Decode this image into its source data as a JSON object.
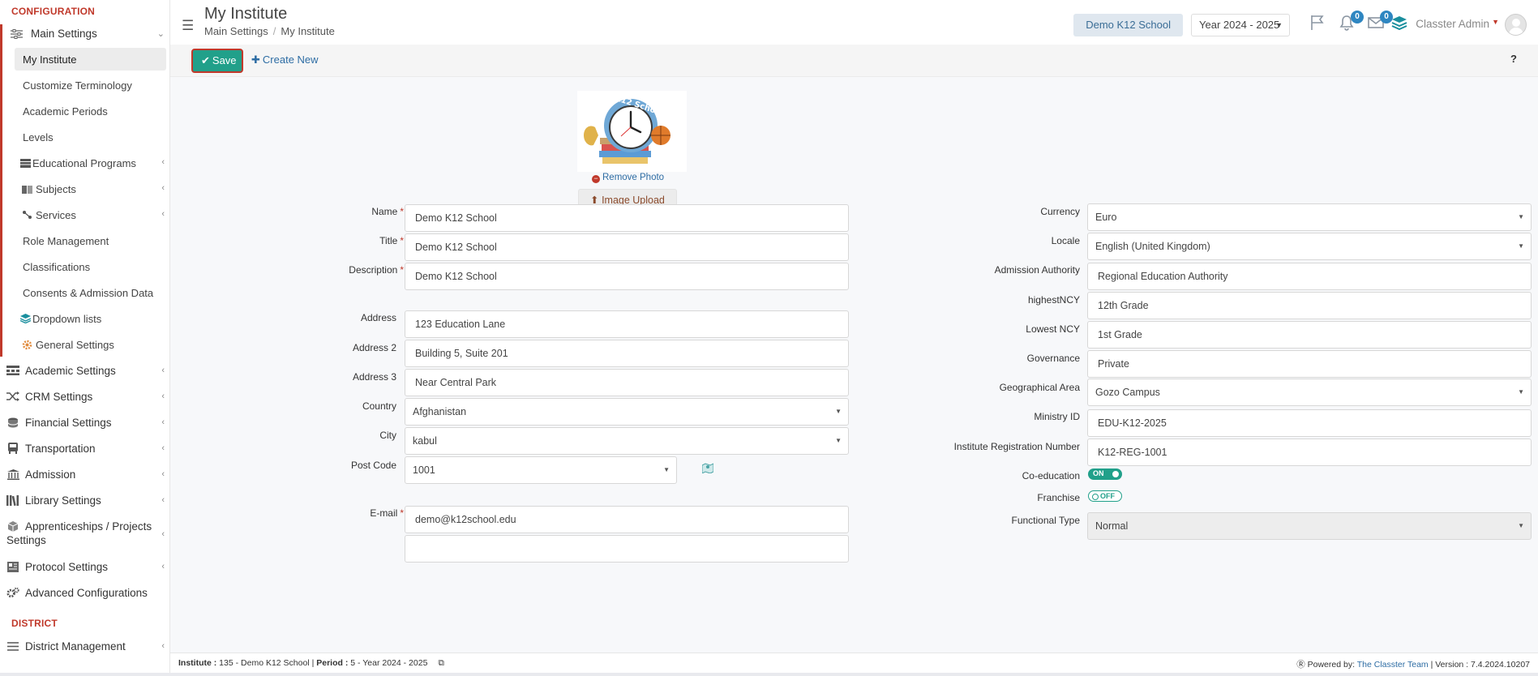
{
  "sidebar": {
    "configuration_heading": "CONFIGURATION",
    "main_settings": "Main Settings",
    "sub_items": {
      "my_institute": "My Institute",
      "customize_terminology": "Customize Terminology",
      "academic_periods": "Academic Periods",
      "levels": "Levels",
      "educational_programs": "Educational Programs",
      "subjects": "Subjects",
      "services": "Services",
      "role_management": "Role Management",
      "classifications": "Classifications",
      "consents": "Consents & Admission Data",
      "dropdown_lists": "Dropdown lists",
      "general_settings": "General Settings"
    },
    "top_items": {
      "academic_settings": "Academic Settings",
      "crm_settings": "CRM Settings",
      "financial_settings": "Financial Settings",
      "transportation": "Transportation",
      "admission": "Admission",
      "library_settings": "Library Settings",
      "apprenticeships_line1": "Apprenticeships / Projects",
      "apprenticeships_line2": "Settings",
      "protocol_settings": "Protocol Settings",
      "advanced_configurations": "Advanced Configurations"
    },
    "district_heading": "DISTRICT",
    "district_management": "District Management"
  },
  "header": {
    "title": "My Institute",
    "breadcrumb_parent": "Main Settings",
    "breadcrumb_sep": "/",
    "breadcrumb_current": "My Institute",
    "school": "Demo K12 School",
    "year": "Year 2024 - 2025",
    "notifications_count": "0",
    "messages_count": "0",
    "user_name": "Classter Admin"
  },
  "toolbar": {
    "save_label": "Save",
    "create_new_label": "Create New",
    "help_label": "?"
  },
  "photo": {
    "logo_text": "My K12 School",
    "remove_label": "Remove Photo",
    "upload_label": "Image Upload"
  },
  "form_left": {
    "name_label": "Name",
    "name_value": "Demo K12 School",
    "title_label": "Title",
    "title_value": "Demo K12 School",
    "description_label": "Description",
    "description_value": "Demo K12 School",
    "address_label": "Address",
    "address_value": "123 Education Lane",
    "address2_label": "Address 2",
    "address2_value": "Building 5, Suite 201",
    "address3_label": "Address 3",
    "address3_value": "Near Central Park",
    "country_label": "Country",
    "country_value": "Afghanistan",
    "city_label": "City",
    "city_value": "kabul",
    "postcode_label": "Post Code",
    "postcode_value": "1001",
    "email_label": "E-mail",
    "email_value": "demo@k12school.edu",
    "required_mark": "*"
  },
  "form_right": {
    "currency_label": "Currency",
    "currency_value": "Euro",
    "locale_label": "Locale",
    "locale_value": "English (United Kingdom)",
    "admission_authority_label": "Admission Authority",
    "admission_authority_value": "Regional Education Authority",
    "highest_ncy_label": "highestNCY",
    "highest_ncy_value": "12th Grade",
    "lowest_ncy_label": "Lowest NCY",
    "lowest_ncy_value": "1st Grade",
    "governance_label": "Governance",
    "governance_value": "Private",
    "geo_area_label": "Geographical Area",
    "geo_area_value": "Gozo Campus",
    "ministry_id_label": "Ministry ID",
    "ministry_id_value": "EDU-K12-2025",
    "reg_number_label": "Institute Registration Number",
    "reg_number_value": "K12-REG-1001",
    "coeducation_label": "Co-education",
    "coeducation_state": "ON",
    "franchise_label": "Franchise",
    "franchise_state": "OFF",
    "functional_type_label": "Functional Type",
    "functional_type_value": "Normal"
  },
  "footer": {
    "institute_label": "Institute :",
    "institute_value": "135 - Demo K12 School",
    "period_label": "Period :",
    "period_value": "5 - Year 2024 - 2025",
    "powered_label": "Powered by:",
    "powered_link": "The Classter Team",
    "version_text": "| Version : 7.4.2024.10207"
  },
  "colors": {
    "accent_red": "#c0392b",
    "save_green": "#21a08a",
    "link_blue": "#2e6da4",
    "badge_blue": "#2e86c1"
  }
}
